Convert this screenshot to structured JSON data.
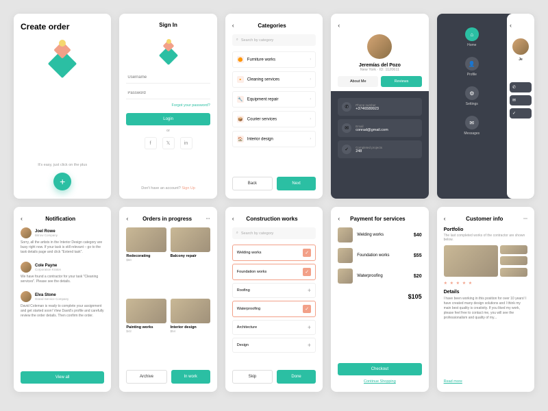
{
  "s1": {
    "title": "Create order",
    "sub": "It's easy, just click on the plus"
  },
  "s2": {
    "title": "Sign In",
    "user": "Username",
    "pass": "Password",
    "forgot": "Forgot your password?",
    "login": "Login",
    "or": "or",
    "noacct": "Don't have an account? ",
    "signup": "Sign Up"
  },
  "s3": {
    "title": "Categories",
    "search": "Search by category",
    "items": [
      "Furniture works",
      "Cleaning services",
      "Equipment repair",
      "Courier services",
      "Interior design"
    ],
    "back": "Back",
    "next": "Next"
  },
  "s4": {
    "name": "Jeremías del Pozo",
    "loc": "New York · ID: 1120611",
    "about": "About Me",
    "reviews": "Reviews",
    "phoneL": "Phone number",
    "phone": "+3746589923",
    "emailL": "Email",
    "email": "conrad@gmail.com",
    "projL": "Completed projects",
    "proj": "248"
  },
  "s5": {
    "items": [
      "Home",
      "Profile",
      "Settings",
      "Messages"
    ],
    "peek": "Je"
  },
  "s6": {
    "title": "Notification",
    "n": [
      {
        "name": "Joel Rowe",
        "co": "Bitrow Company",
        "txt": "Sorry, all the artists in the Interior Design category are busy right now. If your task is still relevant – go to the task details page and click \"Extend task\"."
      },
      {
        "name": "Cole Payne",
        "co": "Corporation Kraton",
        "txt": "We have found a contractor for your task \"Cleaning services\". Please see the details."
      },
      {
        "name": "Elva Stone",
        "co": "Grand Service Company",
        "txt": "David Coleman is ready to complete your assignment and get started soon! View David's profile and carefully review the order details. Then confirm the order."
      }
    ],
    "view": "View all"
  },
  "s7": {
    "title": "Orders in progress",
    "p": [
      {
        "t": "Redecorating",
        "a": "$60"
      },
      {
        "t": "Balcony repair",
        "a": ""
      },
      {
        "t": "Painting works",
        "a": "$42"
      },
      {
        "t": "Interior design",
        "a": "$54"
      }
    ],
    "archive": "Archive",
    "inwork": "In work"
  },
  "s8": {
    "title": "Construction works",
    "search": "Search by category",
    "w": [
      {
        "t": "Welding works",
        "s": true
      },
      {
        "t": "Foundation works",
        "s": true
      },
      {
        "t": "Roofing",
        "s": false
      },
      {
        "t": "Waterproofing",
        "s": true
      },
      {
        "t": "Architecture",
        "s": false
      },
      {
        "t": "Design",
        "s": false
      }
    ],
    "skip": "Skip",
    "done": "Done"
  },
  "s9": {
    "title": "Payment for services",
    "items": [
      {
        "n": "Welding works",
        "p": "$40"
      },
      {
        "n": "Foundation works",
        "p": "$55"
      },
      {
        "n": "Waterproofing",
        "p": "$20"
      }
    ],
    "total": "$105",
    "checkout": "Checkout",
    "cont": "Continue Shopping"
  },
  "s10": {
    "title": "Customer info",
    "portfolio": "Portfolio",
    "psub": "The last completed works of the contractor are shown below.",
    "details": "Details",
    "dtxt": "I have been working in this position for over 10 years! I have created many design solutions and I think my main best quality is creativity. If you liked my work, please feel free to contact me, you will see the professionalism and quality of my...",
    "read": "Read more"
  }
}
